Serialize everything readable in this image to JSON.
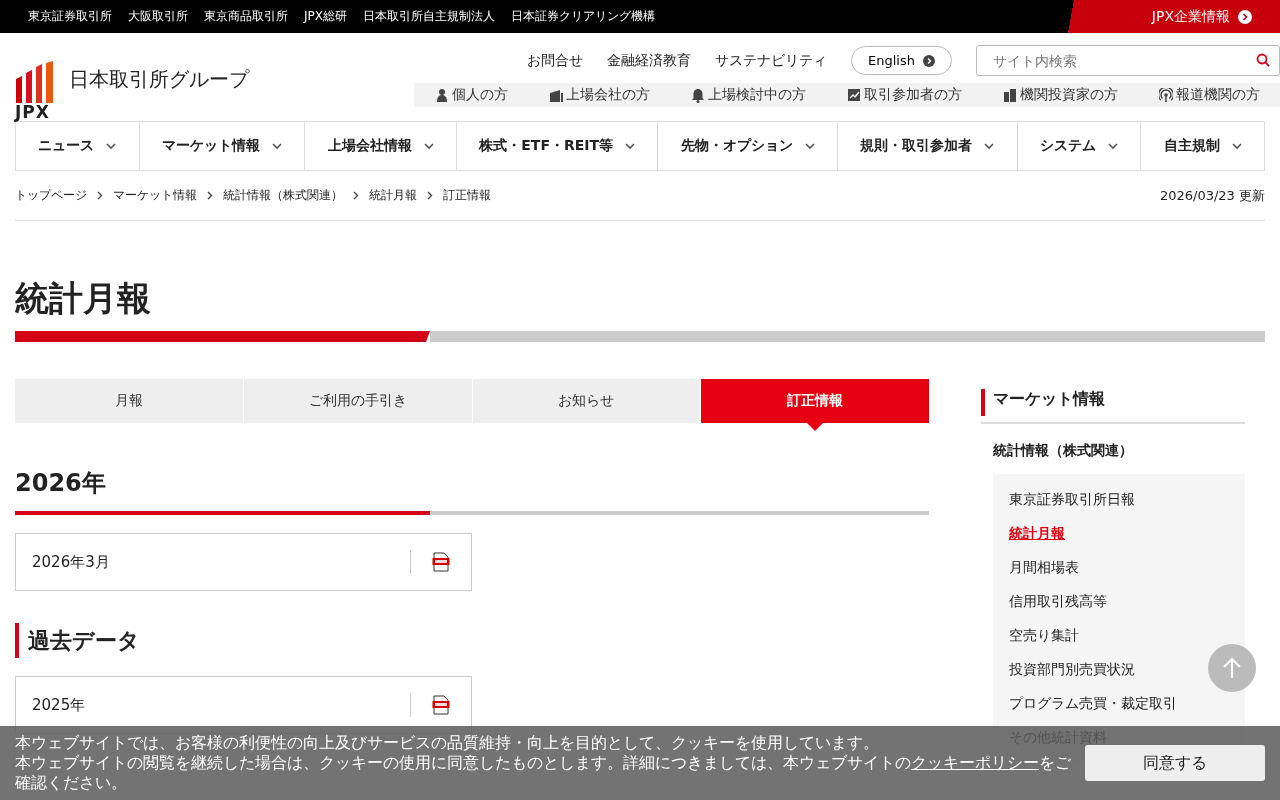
{
  "top_bar": {
    "links": [
      "東京証券取引所",
      "大阪取引所",
      "東京商品取引所",
      "JPX総研",
      "日本取引所自主規制法人",
      "日本証券クリアリング機構"
    ],
    "corporate_link": "JPX企業情報"
  },
  "header": {
    "logo_mark": "JPX",
    "logo_name": "日本取引所グループ",
    "utility_links": [
      "お問合せ",
      "金融経済教育",
      "サステナビリティ"
    ],
    "language_button": "English",
    "search": {
      "placeholder": "サイト内検索"
    },
    "audience_links": [
      {
        "label": "個人の方",
        "kind": "person"
      },
      {
        "label": "上場会社の方",
        "kind": "building"
      },
      {
        "label": "上場検討中の方",
        "kind": "bell"
      },
      {
        "label": "取引参加者の方",
        "kind": "chart"
      },
      {
        "label": "機関投資家の方",
        "kind": "office"
      },
      {
        "label": "報道機関の方",
        "kind": "broadcast"
      }
    ]
  },
  "nav": [
    "ニュース",
    "マーケット情報",
    "上場会社情報",
    "株式・ETF・REIT等",
    "先物・オプション",
    "規則・取引参加者",
    "システム",
    "自主規制"
  ],
  "breadcrumb": [
    "トップページ",
    "マーケット情報",
    "統計情報（株式関連）",
    "統計月報",
    "訂正情報"
  ],
  "updated": "2026/03/23 更新",
  "page_title": "統計月報",
  "tabs": [
    {
      "label": "月報",
      "selected": false
    },
    {
      "label": "ご利用の手引き",
      "selected": false
    },
    {
      "label": "お知らせ",
      "selected": false
    },
    {
      "label": "訂正情報",
      "selected": true
    }
  ],
  "sections": [
    {
      "title": "2026年",
      "kind": "underline",
      "files": [
        "2026年3月"
      ]
    },
    {
      "title": "過去データ",
      "kind": "bar",
      "files": [
        "2025年"
      ]
    }
  ],
  "sidebar": {
    "heading": "マーケット情報",
    "subheading": "統計情報（株式関連）",
    "items": [
      {
        "label": "東京証券取引所日報",
        "selected": false
      },
      {
        "label": "統計月報",
        "selected": true
      },
      {
        "label": "月間相場表",
        "selected": false
      },
      {
        "label": "信用取引残高等",
        "selected": false
      },
      {
        "label": "空売り集計",
        "selected": false
      },
      {
        "label": "投資部門別売買状況",
        "selected": false
      },
      {
        "label": "プログラム売買・裁定取引",
        "selected": false
      },
      {
        "label": "その他統計資料",
        "selected": false
      }
    ]
  },
  "cookie_banner": {
    "line_1": "本ウェブサイトでは、お客様の利便性の向上及びサービスの品質維持・向上を目的として、クッキーを使用しています。",
    "line_2": "本ウェブサイトの閲覧を継続した場合は、クッキーの使用に同意したものとします。詳細につきましては、本ウェブサイトの",
    "link": "クッキーポリシー",
    "line_2_end": "をご確認ください。",
    "button": "同意する"
  }
}
